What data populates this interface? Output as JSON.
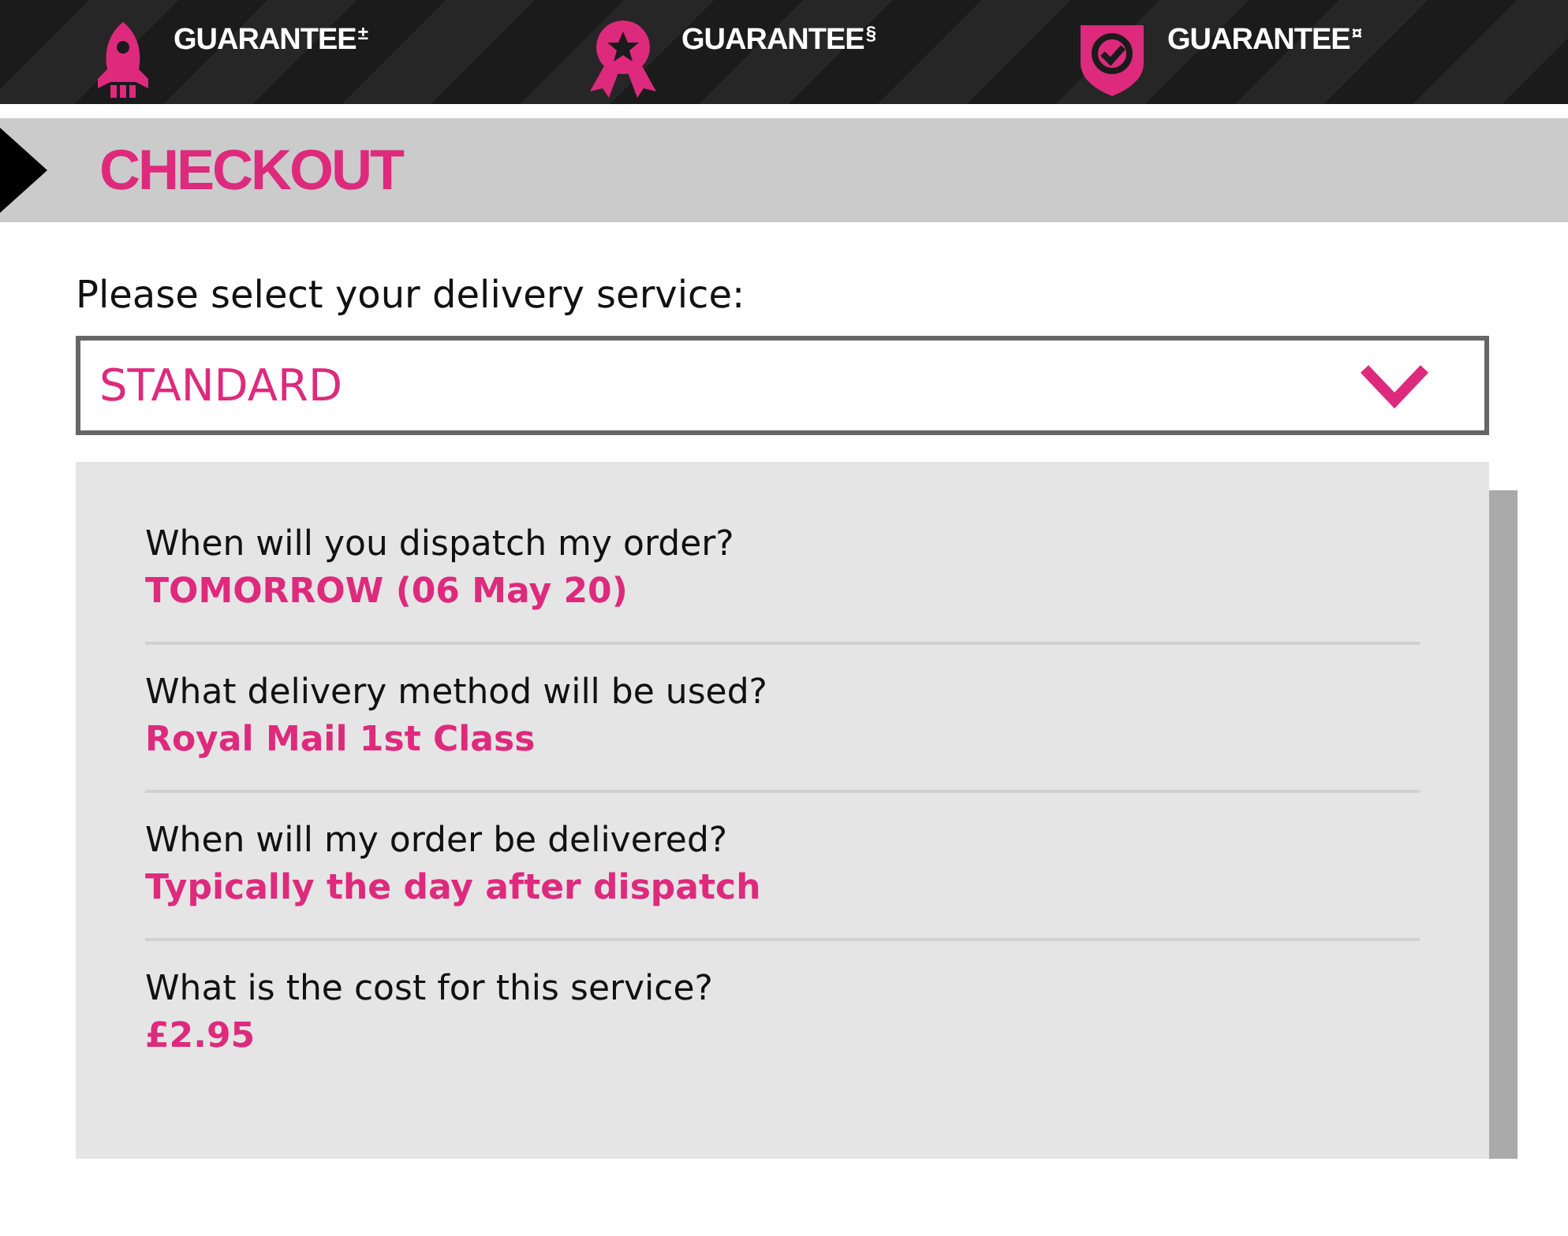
{
  "guarantees": [
    {
      "kind": "rocket",
      "line2": "GUARANTEE",
      "mark": "±"
    },
    {
      "kind": "rosette",
      "line2": "GUARANTEE",
      "mark": "§"
    },
    {
      "kind": "shield",
      "line2": "GUARANTEE",
      "mark": "¤"
    }
  ],
  "section_title": "CHECKOUT",
  "delivery": {
    "label": "Please select your delivery service:",
    "value": "STANDARD"
  },
  "details": [
    {
      "question": "When will you dispatch my order?",
      "answer": "TOMORROW (06 May 20)"
    },
    {
      "question": "What delivery method will be used?",
      "answer": "Royal Mail 1st Class"
    },
    {
      "question": "When will my order be delivered?",
      "answer": "Typically the day after dispatch"
    },
    {
      "question": "What is the cost for this service?",
      "answer": "£2.95"
    }
  ]
}
